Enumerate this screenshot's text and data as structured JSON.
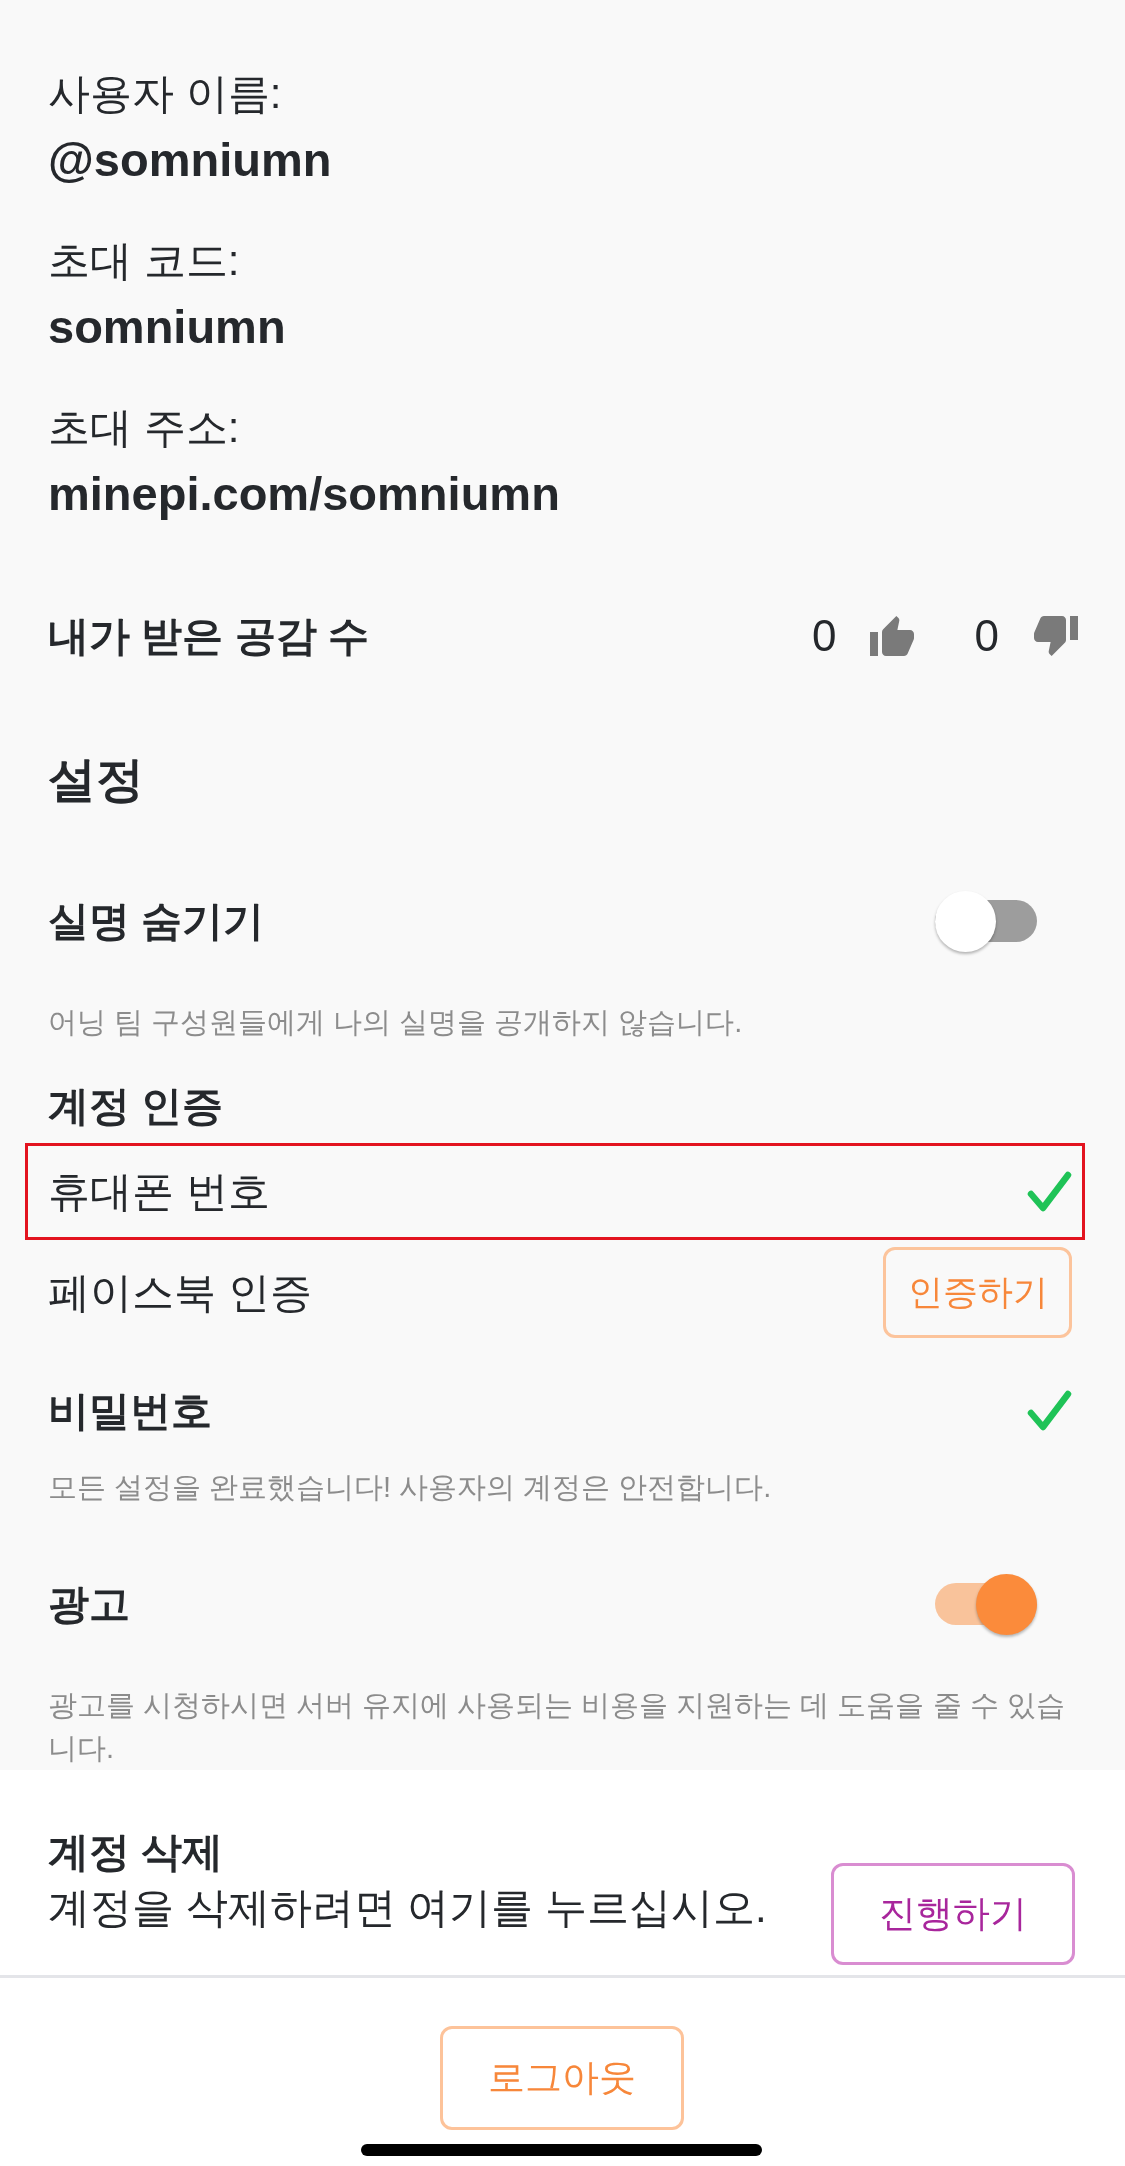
{
  "profile": [
    {
      "label": "사용자 이름:",
      "value": "@somniumn"
    },
    {
      "label": "초대 코드:",
      "value": "somniumn"
    },
    {
      "label": "초대 주소:",
      "value": "minepi.com/somniumn"
    }
  ],
  "reactions": {
    "label": "내가 받은 공감 수",
    "likes": "0",
    "dislikes": "0"
  },
  "settings": {
    "title": "설정",
    "sections": [
      {
        "kind": "toggle",
        "label": "실명 숨기기",
        "on": false,
        "description": "어닝 팀 구성원들에게 나의 실명을 공개하지 않습니다."
      },
      {
        "kind": "verification",
        "title": "계정 인증",
        "items": [
          {
            "label": "휴대폰 번호",
            "verified": true,
            "highlighted": true
          },
          {
            "label": "페이스북 인증",
            "verified": false,
            "highlighted": false,
            "action": "인증하기"
          }
        ]
      },
      {
        "kind": "status",
        "label": "비밀번호",
        "verified": true,
        "description": "모든 설정을 완료했습니다! 사용자의 계정은 안전합니다."
      },
      {
        "kind": "toggle",
        "label": "광고",
        "on": true,
        "description": "광고를 시청하시면 서버 유지에 사용되는 비용을 지원하는 데 도움을 줄 수 있습니다."
      }
    ]
  },
  "delete_account": {
    "title": "계정 삭제",
    "text": "계정을 삭제하려면 여기를 누르십시오.",
    "action": "진행하기"
  },
  "logout": {
    "label": "로그아웃"
  }
}
